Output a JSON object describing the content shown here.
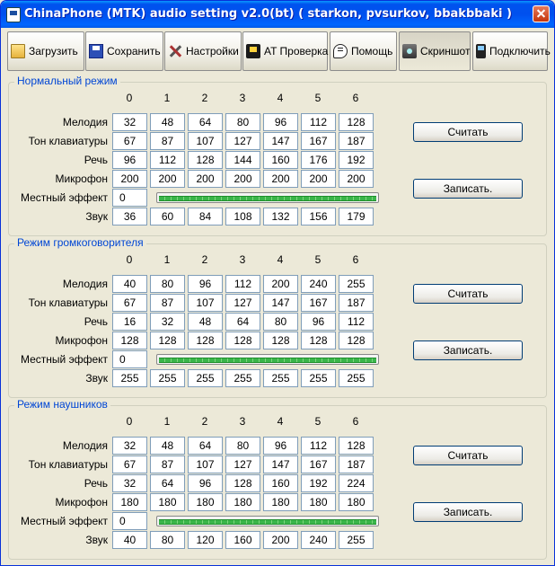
{
  "window": {
    "title": "ChinaPhone (MTK) audio setting v2.0(bt) ( starkon, pvsurkov, bbakbbaki )"
  },
  "toolbar": {
    "load": "Загрузить",
    "save": "Сохранить",
    "settings": "Настройки",
    "at_check": "AT Проверка",
    "help": "Помощь",
    "screenshot": "Скриншот",
    "connect": "Подключить"
  },
  "columns": [
    "0",
    "1",
    "2",
    "3",
    "4",
    "5",
    "6"
  ],
  "rowlabels": {
    "melody": "Мелодия",
    "keytone": "Тон клавиатуры",
    "speech": "Речь",
    "mic": "Микрофон",
    "sidetone": "Местный эффект",
    "sound": "Звук"
  },
  "buttons": {
    "read": "Считать",
    "write": "Записать."
  },
  "modes": [
    {
      "title": "Нормальный режим",
      "melody": [
        "32",
        "48",
        "64",
        "80",
        "96",
        "112",
        "128"
      ],
      "keytone": [
        "67",
        "87",
        "107",
        "127",
        "147",
        "167",
        "187"
      ],
      "speech": [
        "96",
        "112",
        "128",
        "144",
        "160",
        "176",
        "192"
      ],
      "mic": [
        "200",
        "200",
        "200",
        "200",
        "200",
        "200",
        "200"
      ],
      "sidetone": "0",
      "sidetone_level": 1.0,
      "sound": [
        "36",
        "60",
        "84",
        "108",
        "132",
        "156",
        "179"
      ]
    },
    {
      "title": "Режим громкоговорителя",
      "melody": [
        "40",
        "80",
        "96",
        "112",
        "200",
        "240",
        "255"
      ],
      "keytone": [
        "67",
        "87",
        "107",
        "127",
        "147",
        "167",
        "187"
      ],
      "speech": [
        "16",
        "32",
        "48",
        "64",
        "80",
        "96",
        "112"
      ],
      "mic": [
        "128",
        "128",
        "128",
        "128",
        "128",
        "128",
        "128"
      ],
      "sidetone": "0",
      "sidetone_level": 1.0,
      "sound": [
        "255",
        "255",
        "255",
        "255",
        "255",
        "255",
        "255"
      ]
    },
    {
      "title": "Режим наушников",
      "melody": [
        "32",
        "48",
        "64",
        "80",
        "96",
        "112",
        "128"
      ],
      "keytone": [
        "67",
        "87",
        "107",
        "127",
        "147",
        "167",
        "187"
      ],
      "speech": [
        "32",
        "64",
        "96",
        "128",
        "160",
        "192",
        "224"
      ],
      "mic": [
        "180",
        "180",
        "180",
        "180",
        "180",
        "180",
        "180"
      ],
      "sidetone": "0",
      "sidetone_level": 1.0,
      "sound": [
        "40",
        "80",
        "120",
        "160",
        "200",
        "240",
        "255"
      ]
    }
  ]
}
